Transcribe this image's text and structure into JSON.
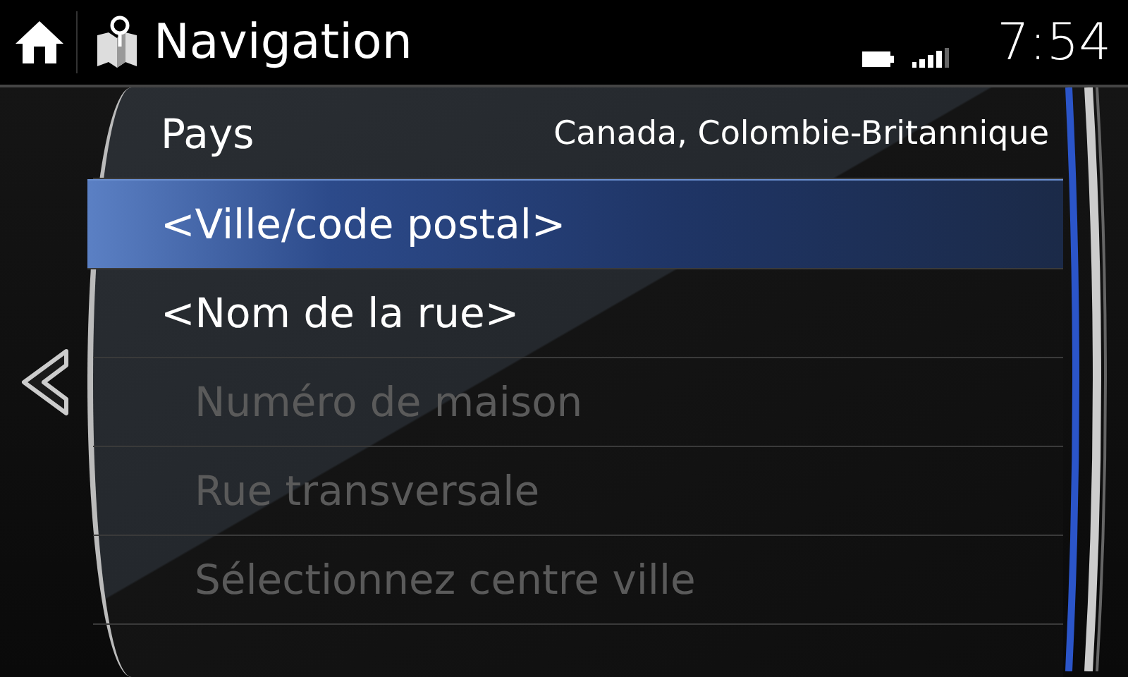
{
  "header": {
    "title": "Navigation",
    "time": "7:54"
  },
  "items": [
    {
      "label": "Pays",
      "value": "Canada, Colombie-Britannique",
      "selected": false,
      "disabled": false
    },
    {
      "label": "<Ville/code postal>",
      "selected": true,
      "disabled": false
    },
    {
      "label": "<Nom de la rue>",
      "selected": false,
      "disabled": false
    },
    {
      "label": "Numéro de maison",
      "selected": false,
      "disabled": true
    },
    {
      "label": "Rue transversale",
      "selected": false,
      "disabled": true
    },
    {
      "label": "Sélectionnez centre ville",
      "selected": false,
      "disabled": true
    }
  ]
}
